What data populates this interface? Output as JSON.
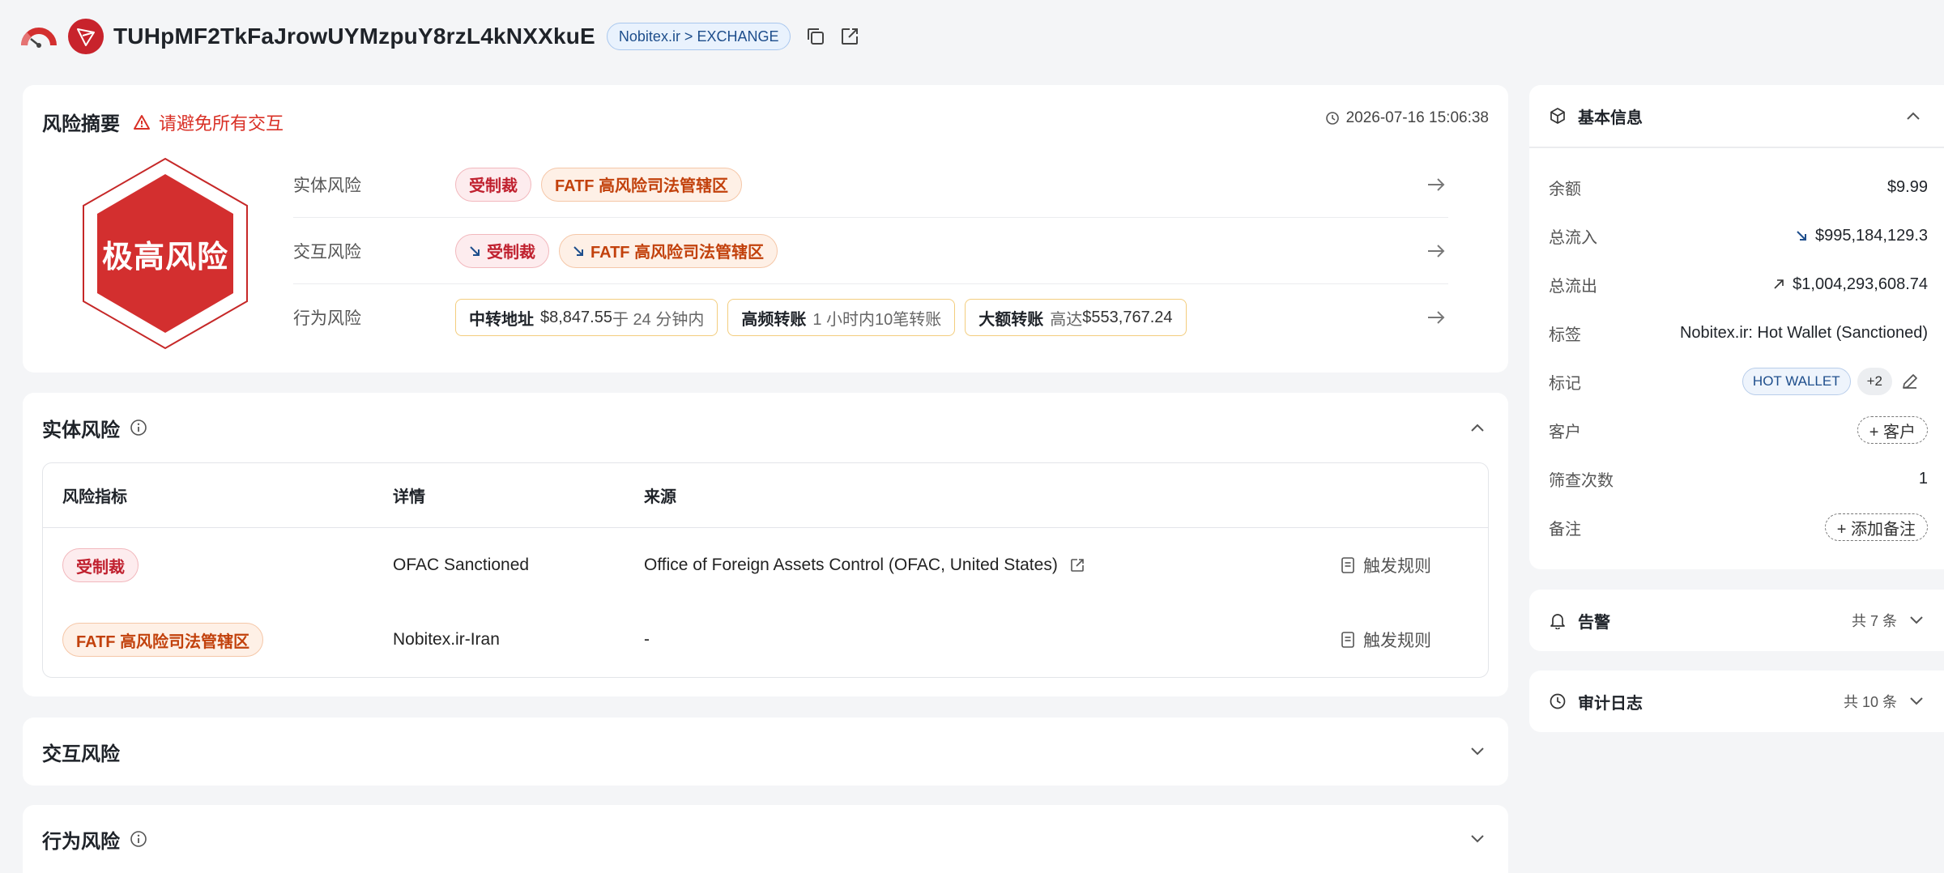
{
  "header": {
    "address": "TUHpMF2TkFaJrowUYMzpuY8rzL4kNXXkuE",
    "entity_pill": "Nobitex.ir > EXCHANGE",
    "icons": [
      "risk-gauge-icon",
      "tron-logo-icon",
      "copy-icon",
      "external-link-icon"
    ]
  },
  "summary": {
    "title": "风险摘要",
    "warning": "请避免所有交互",
    "timestamp": "2026-07-16 15:06:38",
    "risk_level": "极高风险",
    "rows": [
      {
        "label": "实体风险",
        "tags": [
          "受制裁",
          "FATF 高风险司法管辖区"
        ]
      },
      {
        "label": "交互风险",
        "tags": [
          "受制裁",
          "FATF 高风险司法管辖区"
        ]
      },
      {
        "label": "行为风险",
        "tags": [
          {
            "bold": "中转地址",
            "text": "$8,847.55",
            "dim": " 于 24 分钟内"
          },
          {
            "bold": "高频转账",
            "text": "1 小时内10笔转账"
          },
          {
            "bold": "大额转账",
            "dim": "高达",
            "text": " $553,767.24"
          }
        ]
      }
    ]
  },
  "entity_risk": {
    "title": "实体风险",
    "columns": [
      "风险指标",
      "详情",
      "来源"
    ],
    "rows": [
      {
        "indicator": "受制裁",
        "detail": "OFAC Sanctioned",
        "source": "Office of Foreign Assets Control (OFAC, United States)",
        "action": "触发规则"
      },
      {
        "indicator": "FATF 高风险司法管辖区",
        "detail": "Nobitex.ir-Iran",
        "source": "-",
        "action": "触发规则"
      }
    ]
  },
  "interaction_risk": {
    "title": "交互风险"
  },
  "behavior_risk": {
    "title": "行为风险"
  },
  "basic_info": {
    "title": "基本信息",
    "balance": {
      "k": "余额",
      "v": "$9.99"
    },
    "inflow": {
      "k": "总流入",
      "v": "$995,184,129.3"
    },
    "outflow": {
      "k": "总流出",
      "v": "$1,004,293,608.74"
    },
    "label": {
      "k": "标签",
      "v": "Nobitex.ir: Hot Wallet (Sanctioned)"
    },
    "marks": {
      "k": "标记",
      "chip": "HOT WALLET",
      "more": "+2"
    },
    "client": {
      "k": "客户",
      "btn": "+ 客户"
    },
    "screen_count": {
      "k": "筛查次数",
      "v": "1"
    },
    "notes": {
      "k": "备注",
      "btn": "+ 添加备注"
    }
  },
  "alerts": {
    "title": "告警",
    "count": "共 7 条"
  },
  "audit_log": {
    "title": "审计日志",
    "count": "共 10 条"
  },
  "colors": {
    "danger": "#d32f2f",
    "accent_blue": "#1e4e8c",
    "orange": "#c2410c",
    "behavior_border": "#f3cd7e"
  }
}
